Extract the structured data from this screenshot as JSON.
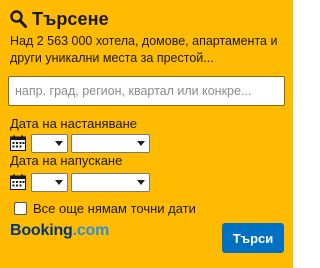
{
  "header": {
    "icon": "search-icon",
    "title": "Търсене"
  },
  "description": "Над 2 563 000 хотела, домове, апартамента и други уникални места за престой...",
  "search": {
    "placeholder": "напр. град, регион, квартал или конкре..."
  },
  "checkin": {
    "label": "Дата на настаняване",
    "icon": "calendar-icon",
    "day_value": "",
    "month_value": ""
  },
  "checkout": {
    "label": "Дата на напускане",
    "icon": "calendar-icon",
    "day_value": "",
    "month_value": ""
  },
  "flexible_dates": {
    "label": "Все още нямам точни дати",
    "checked": false
  },
  "logo": {
    "part1": "Booking",
    "part2": ".com"
  },
  "submit": {
    "label": "Търси"
  },
  "colors": {
    "background": "#febb02",
    "button": "#0071c2",
    "logo_primary": "#003580",
    "logo_accent": "#2e8fd6"
  }
}
